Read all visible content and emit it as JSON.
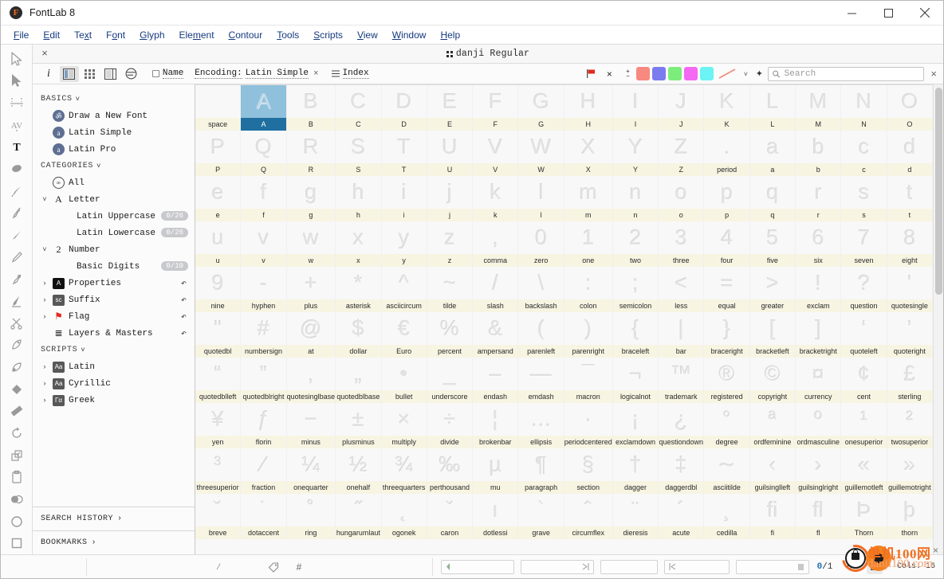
{
  "window": {
    "app_title": "FontLab 8",
    "logo_letter": "F",
    "minimize_label": "Minimize",
    "maximize_label": "Maximize",
    "close_label": "Close"
  },
  "menubar": {
    "items": [
      {
        "label": "File",
        "accel": "F"
      },
      {
        "label": "Edit",
        "accel": "E"
      },
      {
        "label": "Text",
        "accel": "x"
      },
      {
        "label": "Font",
        "accel": "o"
      },
      {
        "label": "Glyph",
        "accel": "G"
      },
      {
        "label": "Element",
        "accel": "m"
      },
      {
        "label": "Contour",
        "accel": "C"
      },
      {
        "label": "Tools",
        "accel": "T"
      },
      {
        "label": "Scripts",
        "accel": "S"
      },
      {
        "label": "View",
        "accel": "V"
      },
      {
        "label": "Window",
        "accel": "W"
      },
      {
        "label": "Help",
        "accel": "H"
      }
    ]
  },
  "toolpalette": {
    "tools": [
      {
        "name": "arrow-tool",
        "icon": "cursor-arrow"
      },
      {
        "name": "select-tool",
        "icon": "cursor-filled"
      },
      {
        "name": "metrics-tool",
        "icon": "metrics"
      },
      {
        "name": "kerning-tool",
        "icon": "kerning-av"
      },
      {
        "name": "text-tool",
        "icon": "text-t",
        "active": true
      },
      {
        "name": "eraser-tool",
        "icon": "eraser"
      },
      {
        "name": "brush-tool",
        "icon": "brush"
      },
      {
        "name": "pen-tool",
        "icon": "pen"
      },
      {
        "name": "rapid-tool",
        "icon": "rapid"
      },
      {
        "name": "pencil-tool",
        "icon": "pencil"
      },
      {
        "name": "tunni-tool",
        "icon": "tunni"
      },
      {
        "name": "fill-tool",
        "icon": "paintbrush"
      },
      {
        "name": "scissors-tool",
        "icon": "scissors"
      },
      {
        "name": "knife-tool",
        "icon": "knife"
      },
      {
        "name": "scale-tool",
        "icon": "scale"
      },
      {
        "name": "paintbucket-tool",
        "icon": "paint-bucket"
      },
      {
        "name": "measure-tool",
        "icon": "ruler"
      },
      {
        "name": "rotate-tool",
        "icon": "rotate"
      },
      {
        "name": "transform-tool",
        "icon": "transform"
      },
      {
        "name": "clipboard-tool",
        "icon": "clipboard"
      },
      {
        "name": "shape-tool",
        "icon": "shape-union"
      },
      {
        "name": "ellipse-tool",
        "icon": "ellipse"
      },
      {
        "name": "rectangle-tool",
        "icon": "rectangle"
      }
    ]
  },
  "tab": {
    "title": "danji Regular",
    "close_label": "×"
  },
  "optionbar": {
    "info_label": "i",
    "views": [
      {
        "name": "panel-view",
        "selected": true
      },
      {
        "name": "grid-view",
        "selected": false
      },
      {
        "name": "list-view",
        "selected": false
      }
    ],
    "filter_icon_label": "filter",
    "name_label": "Name",
    "encoding_label": "Encoding:",
    "encoding_value": "Latin Simple",
    "encoding_clear": "×",
    "index_label": "Index",
    "flag_label": "flag",
    "mark_clear": "×",
    "plusminus_plus": "+",
    "plusminus_minus": "−",
    "swatches": [
      "#f98880",
      "#7b7bf0",
      "#7ced7c",
      "#f468f4",
      "#6cf3f3"
    ],
    "dropdown_caret": "˅",
    "pin_label": "✦",
    "panel_close": "×"
  },
  "search": {
    "placeholder": "Search",
    "value": "",
    "icon": "search-icon"
  },
  "leftpanel": {
    "sections": [
      {
        "title": "BASICS",
        "caret": "˅",
        "items": [
          {
            "label": "Draw a New Font",
            "icon": "circle-glyph-icon",
            "icon_text": "ॐ",
            "arrow": "",
            "badge": "",
            "revert": false
          },
          {
            "label": "Latin Simple",
            "icon": "circle-glyph-icon",
            "icon_text": "a",
            "arrow": "",
            "badge": "",
            "revert": false
          },
          {
            "label": "Latin Pro",
            "icon": "circle-glyph-icon",
            "icon_text": "a",
            "arrow": "",
            "badge": "",
            "revert": false
          }
        ]
      },
      {
        "title": "CATEGORIES",
        "caret": "˅",
        "items": [
          {
            "label": "All",
            "icon": "infinity-circle-icon",
            "icon_text": "∞",
            "arrow": "",
            "badge": "",
            "revert": false
          },
          {
            "label": "Letter",
            "icon": "letter-a-icon",
            "icon_text": "A",
            "arrow": "˅",
            "badge": "",
            "revert": false
          },
          {
            "label": "Latin Uppercase",
            "icon": "",
            "icon_text": "",
            "arrow": "",
            "badge": "0/26",
            "revert": false,
            "indent": true
          },
          {
            "label": "Latin Lowercase",
            "icon": "",
            "icon_text": "",
            "arrow": "",
            "badge": "0/26",
            "revert": false,
            "indent": true
          },
          {
            "label": "Number",
            "icon": "digit-two-icon",
            "icon_text": "2",
            "arrow": "˅",
            "badge": "",
            "revert": false
          },
          {
            "label": "Basic Digits",
            "icon": "",
            "icon_text": "",
            "arrow": "",
            "badge": "0/10",
            "revert": false,
            "indent": true
          },
          {
            "label": "Properties",
            "icon": "black-a-icon",
            "icon_text": "A",
            "arrow": "›",
            "badge": "",
            "revert": true
          },
          {
            "label": "Suffix",
            "icon": "suffix-icon",
            "icon_text": "sc",
            "arrow": "›",
            "badge": "",
            "revert": true
          },
          {
            "label": "Flag",
            "icon": "flag-icon",
            "icon_text": "⚑",
            "arrow": "›",
            "badge": "",
            "revert": true
          },
          {
            "label": "Layers & Masters",
            "icon": "layers-icon",
            "icon_text": "≣",
            "arrow": "",
            "badge": "",
            "revert": true
          }
        ]
      },
      {
        "title": "SCRIPTS",
        "caret": "˅",
        "items": [
          {
            "label": "Latin",
            "icon": "script-latin-icon",
            "icon_text": "Aa",
            "arrow": "›",
            "badge": "",
            "revert": false
          },
          {
            "label": "Cyrillic",
            "icon": "script-cyrillic-icon",
            "icon_text": "Аа",
            "arrow": "›",
            "badge": "",
            "revert": false
          },
          {
            "label": "Greek",
            "icon": "script-greek-icon",
            "icon_text": "Γα",
            "arrow": "›",
            "badge": "",
            "revert": false
          }
        ]
      }
    ],
    "footers": [
      {
        "label": "SEARCH HISTORY",
        "caret": "›"
      },
      {
        "label": "BOOKMARKS",
        "caret": "›"
      }
    ]
  },
  "glyphgrid": {
    "columns": 16,
    "selected_index": 1,
    "cells": [
      {
        "name": "space",
        "art": ""
      },
      {
        "name": "A",
        "art": "A"
      },
      {
        "name": "B",
        "art": "B"
      },
      {
        "name": "C",
        "art": "C"
      },
      {
        "name": "D",
        "art": "D"
      },
      {
        "name": "E",
        "art": "E"
      },
      {
        "name": "F",
        "art": "F"
      },
      {
        "name": "G",
        "art": "G"
      },
      {
        "name": "H",
        "art": "H"
      },
      {
        "name": "I",
        "art": "I"
      },
      {
        "name": "J",
        "art": "J"
      },
      {
        "name": "K",
        "art": "K"
      },
      {
        "name": "L",
        "art": "L"
      },
      {
        "name": "M",
        "art": "M"
      },
      {
        "name": "N",
        "art": "N"
      },
      {
        "name": "O",
        "art": "O"
      },
      {
        "name": "P",
        "art": "P"
      },
      {
        "name": "Q",
        "art": "Q"
      },
      {
        "name": "R",
        "art": "R"
      },
      {
        "name": "S",
        "art": "S"
      },
      {
        "name": "T",
        "art": "T"
      },
      {
        "name": "U",
        "art": "U"
      },
      {
        "name": "V",
        "art": "V"
      },
      {
        "name": "W",
        "art": "W"
      },
      {
        "name": "X",
        "art": "X"
      },
      {
        "name": "Y",
        "art": "Y"
      },
      {
        "name": "Z",
        "art": "Z"
      },
      {
        "name": "period",
        "art": "."
      },
      {
        "name": "a",
        "art": "a"
      },
      {
        "name": "b",
        "art": "b"
      },
      {
        "name": "c",
        "art": "c"
      },
      {
        "name": "d",
        "art": "d"
      },
      {
        "name": "e",
        "art": "e"
      },
      {
        "name": "f",
        "art": "f"
      },
      {
        "name": "g",
        "art": "g"
      },
      {
        "name": "h",
        "art": "h"
      },
      {
        "name": "i",
        "art": "i"
      },
      {
        "name": "j",
        "art": "j"
      },
      {
        "name": "k",
        "art": "k"
      },
      {
        "name": "l",
        "art": "l"
      },
      {
        "name": "m",
        "art": "m"
      },
      {
        "name": "n",
        "art": "n"
      },
      {
        "name": "o",
        "art": "o"
      },
      {
        "name": "p",
        "art": "p"
      },
      {
        "name": "q",
        "art": "q"
      },
      {
        "name": "r",
        "art": "r"
      },
      {
        "name": "s",
        "art": "s"
      },
      {
        "name": "t",
        "art": "t"
      },
      {
        "name": "u",
        "art": "u"
      },
      {
        "name": "v",
        "art": "v"
      },
      {
        "name": "w",
        "art": "w"
      },
      {
        "name": "x",
        "art": "x"
      },
      {
        "name": "y",
        "art": "y"
      },
      {
        "name": "z",
        "art": "z"
      },
      {
        "name": "comma",
        "art": ","
      },
      {
        "name": "zero",
        "art": "0"
      },
      {
        "name": "one",
        "art": "1"
      },
      {
        "name": "two",
        "art": "2"
      },
      {
        "name": "three",
        "art": "3"
      },
      {
        "name": "four",
        "art": "4"
      },
      {
        "name": "five",
        "art": "5"
      },
      {
        "name": "six",
        "art": "6"
      },
      {
        "name": "seven",
        "art": "7"
      },
      {
        "name": "eight",
        "art": "8"
      },
      {
        "name": "nine",
        "art": "9"
      },
      {
        "name": "hyphen",
        "art": "-"
      },
      {
        "name": "plus",
        "art": "+"
      },
      {
        "name": "asterisk",
        "art": "*"
      },
      {
        "name": "asciicircum",
        "art": "^"
      },
      {
        "name": "tilde",
        "art": "~"
      },
      {
        "name": "slash",
        "art": "/"
      },
      {
        "name": "backslash",
        "art": "\\"
      },
      {
        "name": "colon",
        "art": ":"
      },
      {
        "name": "semicolon",
        "art": ";"
      },
      {
        "name": "less",
        "art": "<"
      },
      {
        "name": "equal",
        "art": "="
      },
      {
        "name": "greater",
        "art": ">"
      },
      {
        "name": "exclam",
        "art": "!"
      },
      {
        "name": "question",
        "art": "?"
      },
      {
        "name": "quotesingle",
        "art": "'"
      },
      {
        "name": "quotedbl",
        "art": "\""
      },
      {
        "name": "numbersign",
        "art": "#"
      },
      {
        "name": "at",
        "art": "@"
      },
      {
        "name": "dollar",
        "art": "$"
      },
      {
        "name": "Euro",
        "art": "€"
      },
      {
        "name": "percent",
        "art": "%"
      },
      {
        "name": "ampersand",
        "art": "&"
      },
      {
        "name": "parenleft",
        "art": "("
      },
      {
        "name": "parenright",
        "art": ")"
      },
      {
        "name": "braceleft",
        "art": "{"
      },
      {
        "name": "bar",
        "art": "|"
      },
      {
        "name": "braceright",
        "art": "}"
      },
      {
        "name": "bracketleft",
        "art": "["
      },
      {
        "name": "bracketright",
        "art": "]"
      },
      {
        "name": "quoteleft",
        "art": "‘"
      },
      {
        "name": "quoteright",
        "art": "’"
      },
      {
        "name": "quotedblleft",
        "art": "“"
      },
      {
        "name": "quotedblright",
        "art": "”"
      },
      {
        "name": "quotesinglbase",
        "art": "‚"
      },
      {
        "name": "quotedblbase",
        "art": "„"
      },
      {
        "name": "bullet",
        "art": "•"
      },
      {
        "name": "underscore",
        "art": "_"
      },
      {
        "name": "endash",
        "art": "–"
      },
      {
        "name": "emdash",
        "art": "—"
      },
      {
        "name": "macron",
        "art": "¯"
      },
      {
        "name": "logicalnot",
        "art": "¬"
      },
      {
        "name": "trademark",
        "art": "™"
      },
      {
        "name": "registered",
        "art": "®"
      },
      {
        "name": "copyright",
        "art": "©"
      },
      {
        "name": "currency",
        "art": "¤"
      },
      {
        "name": "cent",
        "art": "¢"
      },
      {
        "name": "sterling",
        "art": "£"
      },
      {
        "name": "yen",
        "art": "¥"
      },
      {
        "name": "florin",
        "art": "ƒ"
      },
      {
        "name": "minus",
        "art": "−"
      },
      {
        "name": "plusminus",
        "art": "±"
      },
      {
        "name": "multiply",
        "art": "×"
      },
      {
        "name": "divide",
        "art": "÷"
      },
      {
        "name": "brokenbar",
        "art": "¦"
      },
      {
        "name": "ellipsis",
        "art": "…"
      },
      {
        "name": "periodcentered",
        "art": "·"
      },
      {
        "name": "exclamdown",
        "art": "¡"
      },
      {
        "name": "questiondown",
        "art": "¿"
      },
      {
        "name": "degree",
        "art": "°"
      },
      {
        "name": "ordfeminine",
        "art": "ª"
      },
      {
        "name": "ordmasculine",
        "art": "º"
      },
      {
        "name": "onesuperior",
        "art": "¹"
      },
      {
        "name": "twosuperior",
        "art": "²"
      },
      {
        "name": "threesuperior",
        "art": "³"
      },
      {
        "name": "fraction",
        "art": "⁄"
      },
      {
        "name": "onequarter",
        "art": "¼"
      },
      {
        "name": "onehalf",
        "art": "½"
      },
      {
        "name": "threequarters",
        "art": "¾"
      },
      {
        "name": "perthousand",
        "art": "‰"
      },
      {
        "name": "mu",
        "art": "µ"
      },
      {
        "name": "paragraph",
        "art": "¶"
      },
      {
        "name": "section",
        "art": "§"
      },
      {
        "name": "dagger",
        "art": "†"
      },
      {
        "name": "daggerdbl",
        "art": "‡"
      },
      {
        "name": "asciitilde",
        "art": "∼"
      },
      {
        "name": "guilsinglleft",
        "art": "‹"
      },
      {
        "name": "guilsinglright",
        "art": "›"
      },
      {
        "name": "guillemotleft",
        "art": "«"
      },
      {
        "name": "guillemotright",
        "art": "»"
      },
      {
        "name": "breve",
        "art": "˘"
      },
      {
        "name": "dotaccent",
        "art": "˙"
      },
      {
        "name": "ring",
        "art": "˚"
      },
      {
        "name": "hungarumlaut",
        "art": "˝"
      },
      {
        "name": "ogonek",
        "art": "˛"
      },
      {
        "name": "caron",
        "art": "ˇ"
      },
      {
        "name": "dotlessi",
        "art": "ı"
      },
      {
        "name": "grave",
        "art": "`"
      },
      {
        "name": "circumflex",
        "art": "ˆ"
      },
      {
        "name": "dieresis",
        "art": "¨"
      },
      {
        "name": "acute",
        "art": "´"
      },
      {
        "name": "cedilla",
        "art": "¸"
      },
      {
        "name": "fi",
        "art": "ﬁ"
      },
      {
        "name": "fl",
        "art": "ﬂ"
      },
      {
        "name": "Thorn",
        "art": "Þ"
      },
      {
        "name": "thorn",
        "art": "þ"
      }
    ]
  },
  "statusbar": {
    "slash_label": "/",
    "tag_icon": "tag-icon",
    "hash_icon": "hash-icon",
    "field1_value": "",
    "field2_value": "",
    "field3_value": "",
    "field4_value": "",
    "field5_value": "",
    "selection_count": "0",
    "selection_total": "/1",
    "zoom_value": "0",
    "mode_icon": "square-icon",
    "cols_label": "Cols: 16"
  },
  "watermark": {
    "line1": "单机100网",
    "line2": "danji100.com",
    "close": "×"
  }
}
